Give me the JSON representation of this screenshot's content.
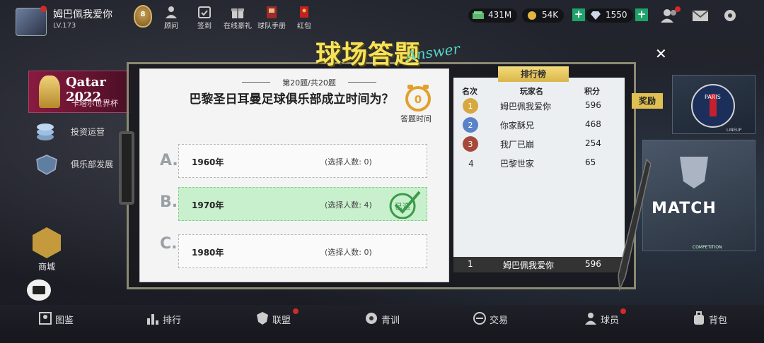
{
  "player": {
    "name": "姆巴佩我爱你",
    "level": "LV.173",
    "rank_badge": "8"
  },
  "top_menu": [
    {
      "label": "顾问",
      "icon": "advisor-icon"
    },
    {
      "label": "签到",
      "icon": "checkin-icon"
    },
    {
      "label": "在线豪礼",
      "icon": "gift-icon"
    },
    {
      "label": "球队手册",
      "icon": "handbook-icon"
    },
    {
      "label": "红包",
      "icon": "red-envelope-icon"
    }
  ],
  "resources": {
    "cash": "431M",
    "coins": "54K",
    "diamonds": "1550"
  },
  "side_menu": {
    "banner_title": "Qatar 2022",
    "banner_sub": "卡塔尔世界杯",
    "items": [
      {
        "label": "投资运营",
        "icon": "coins-stack-icon"
      },
      {
        "label": "俱乐部发展",
        "icon": "club-badge-icon"
      }
    ],
    "shop_label": "商城"
  },
  "quiz": {
    "title": "球场答题",
    "title_sub": "Answer",
    "counter": "第20题/共20题",
    "question": "巴黎圣日耳曼足球俱乐部成立时间为？",
    "timer_value": "0",
    "timer_label": "答题时间",
    "options": [
      {
        "letter": "A.",
        "value": "1960年",
        "count_text": "(选择人数: 0)",
        "selected": false
      },
      {
        "letter": "B.",
        "value": "1970年",
        "count_text": "(选择人数: 4)",
        "selected": true
      },
      {
        "letter": "C.",
        "value": "1980年",
        "count_text": "(选择人数: 0)",
        "selected": false
      }
    ],
    "selected_stamp": "已选"
  },
  "leaderboard": {
    "tab_label": "排行榜",
    "headers": {
      "rank": "名次",
      "name": "玩家名",
      "score": "积分"
    },
    "rows": [
      {
        "rank": "1",
        "name": "姆巴佩我爱你",
        "score": "596",
        "medal": "gold"
      },
      {
        "rank": "2",
        "name": "你家酥兄",
        "score": "468",
        "medal": "silver"
      },
      {
        "rank": "3",
        "name": "我厂已崩",
        "score": "254",
        "medal": "bronze"
      },
      {
        "rank": "4",
        "name": "巴黎世家",
        "score": "65",
        "medal": ""
      }
    ],
    "mine": {
      "rank": "1",
      "name": "姆巴佩我爱你",
      "score": "596"
    },
    "reward_label": "奖励"
  },
  "right_cards": {
    "psg_label": "PARIS",
    "lineup": "LINEUP",
    "match_label": "MATCH",
    "match_sub": "COMPETITION"
  },
  "bottom_nav": [
    {
      "label": "图鉴",
      "icon": "codex-icon",
      "dot": false
    },
    {
      "label": "排行",
      "icon": "ranking-icon",
      "dot": false
    },
    {
      "label": "联盟",
      "icon": "league-icon",
      "dot": true
    },
    {
      "label": "青训",
      "icon": "youth-training-icon",
      "dot": false
    },
    {
      "label": "交易",
      "icon": "trade-icon",
      "dot": false
    },
    {
      "label": "球员",
      "icon": "player-icon",
      "dot": true
    },
    {
      "label": "背包",
      "icon": "backpack-icon",
      "dot": false
    }
  ],
  "colors": {
    "accent_green": "#1fa36b",
    "title_yellow": "#f6e25a",
    "selected_option": "#c8f0cc",
    "notify_red": "#d02a2a"
  }
}
